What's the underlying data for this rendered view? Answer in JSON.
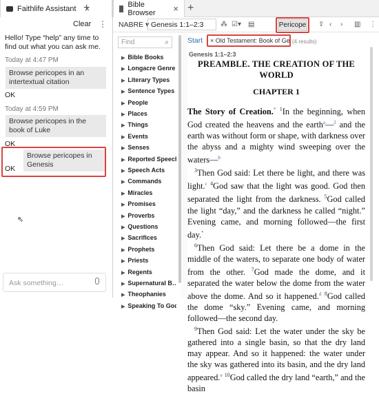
{
  "tabs": {
    "left": {
      "label": "Faithlife Assistant"
    },
    "right": {
      "label": "Bible Browser"
    }
  },
  "assistant": {
    "clear_label": "Clear",
    "intro": "Hello! Type “help” any time to find out what you can ask me.",
    "messages": [
      {
        "time": "Today at 4:47 PM",
        "prompt": "Browse pericopes in an intertextual citation",
        "reply": "OK"
      },
      {
        "time": "Today at 4:59 PM",
        "prompt": "Browse pericopes in the book of Luke",
        "reply": ""
      },
      {
        "time": "",
        "prompt": "Browse pericopes in Genesis",
        "reply": "OK"
      }
    ],
    "ok_after_luke": "OK",
    "input_placeholder": "Ask something…"
  },
  "toolbar": {
    "version": "NABRE",
    "reference": "Genesis 1:1–2:3",
    "pericope_label": "Pericope"
  },
  "sidebar": {
    "find_placeholder": "Find",
    "items": [
      "Bible Books",
      "Longacre Genre",
      "Literary Types",
      "Sentence Types",
      "People",
      "Places",
      "Things",
      "Events",
      "Senses",
      "Reported Speech",
      "Speech Acts",
      "Commands",
      "Miracles",
      "Promises",
      "Proverbs",
      "Questions",
      "Sacrifices",
      "Prophets",
      "Priests",
      "Regents",
      "Supernatural B…",
      "Theophanies",
      "Speaking To God"
    ]
  },
  "reader": {
    "start": "Start",
    "filter": "× Old Testament: Book of Genesis",
    "results": "(4 results)",
    "book_ref": "Genesis 1:1–2:3",
    "title": "PREAMBLE. THE CREATION OF THE WORLD",
    "chapter": "CHAPTER 1",
    "section": "The Story of Creation.",
    "v1": "In the beginning, when God created the heavens and the earth",
    "v2": "and the earth was without form or shape, with darkness over the abyss and a mighty wind sweeping over the waters—",
    "v3": "Then God said: Let there be light, and there was light.",
    "v4": "God saw that the light was good. God then separated the light from the darkness.",
    "v5": "God called the light “day,” and the darkness he called “night.” Evening came, and morning followed—the first day.",
    "v6": "Then God said: Let there be a dome in the middle of the waters, to separate one body of water from the other.",
    "v7": "God made the dome, and it separated the water below the dome from the water above the dome. And so it happened.",
    "v8": "God called the dome “sky.” Evening came, and morning followed—the second day.",
    "v9a": "Then God said: Let the water under the sky be gathered into a single basin, so that the dry land may appear. And so it happened: the water under the sky was gathered into its basin, and the dry land appeared.",
    "v10": "God called the dry land “earth,” and the basin"
  },
  "colors": {
    "accent_red": "#d9433e",
    "link_blue": "#2a6db0"
  }
}
